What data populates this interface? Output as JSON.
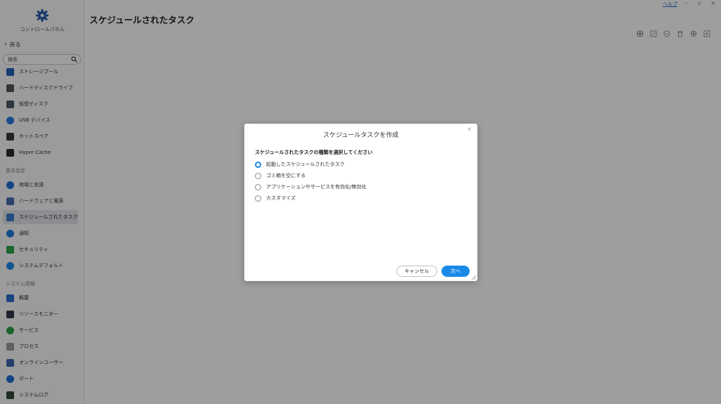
{
  "sidebar": {
    "app_title": "コントロールパネル",
    "back_label": "戻る",
    "search_placeholder": "検索",
    "items": [
      {
        "label": "ストレージプール",
        "icon": "storage-pool-icon",
        "color": "#1f5fbf"
      },
      {
        "label": "ハードディスクドライブ",
        "icon": "hard-drive-icon",
        "color": "#555555"
      },
      {
        "label": "仮想ディスク",
        "icon": "virtual-disk-icon",
        "color": "#4a5a6a"
      },
      {
        "label": "USB デバイス",
        "icon": "usb-device-icon",
        "color": "#2a7de0"
      },
      {
        "label": "ホットスペア",
        "icon": "hot-spare-icon",
        "color": "#3a3a3a"
      },
      {
        "label": "Hyper Cache",
        "icon": "hyper-cache-icon",
        "color": "#2b2b2b"
      },
      {
        "label": "地域と言語",
        "icon": "region-language-icon",
        "color": "#1f6fd0"
      },
      {
        "label": "ハードウェアと電源",
        "icon": "hardware-power-icon",
        "color": "#4a6ab0"
      },
      {
        "label": "スケジュールされたタスク",
        "icon": "scheduled-task-icon",
        "color": "#3a7dd0"
      },
      {
        "label": "通知",
        "icon": "notification-icon",
        "color": "#1f7fe0"
      },
      {
        "label": "セキュリティ",
        "icon": "security-icon",
        "color": "#2aa34a"
      },
      {
        "label": "システムデフォルト",
        "icon": "system-default-icon",
        "color": "#1a8ae8"
      },
      {
        "label": "概要",
        "icon": "overview-icon",
        "color": "#2a6fd0"
      },
      {
        "label": "リソースモニター",
        "icon": "resource-monitor-icon",
        "color": "#2f3b4a"
      },
      {
        "label": "サービス",
        "icon": "service-icon",
        "color": "#2aa34a"
      },
      {
        "label": "プロセス",
        "icon": "process-icon",
        "color": "#9a9a9a"
      },
      {
        "label": "オンラインユーザー",
        "icon": "online-user-icon",
        "color": "#3a6ab0"
      },
      {
        "label": "ポート",
        "icon": "port-icon",
        "color": "#1f6fd0"
      },
      {
        "label": "システムログ",
        "icon": "system-log-icon",
        "color": "#2f4a3a"
      }
    ],
    "section_basic": "基本設定",
    "section_system_info": "システム情報"
  },
  "main": {
    "title": "スケジュールされたタスク",
    "help_label": "ヘルプ",
    "minimize": "–",
    "restore": "▫",
    "close": "×",
    "toolbar_icons": [
      "add-icon",
      "edit-icon",
      "disable-icon",
      "delete-icon",
      "settings-icon",
      "more-icon"
    ]
  },
  "dialog": {
    "title": "スケジュールタスクを作成",
    "close": "×",
    "prompt": "スケジュールされたタスクの種類を選択してください",
    "options": [
      {
        "label": "起動したスケジュールされたタスク",
        "selected": true
      },
      {
        "label": "ゴミ箱を空にする",
        "selected": false
      },
      {
        "label": "アプリケーションやサービスを有効化/無効化",
        "selected": false
      },
      {
        "label": "カスタマイズ",
        "selected": false
      }
    ],
    "cancel_label": "キャンセル",
    "next_label": "次へ"
  },
  "colors": {
    "accent": "#1a8ae8",
    "overlay": "rgba(0,0,0,0.38)"
  }
}
